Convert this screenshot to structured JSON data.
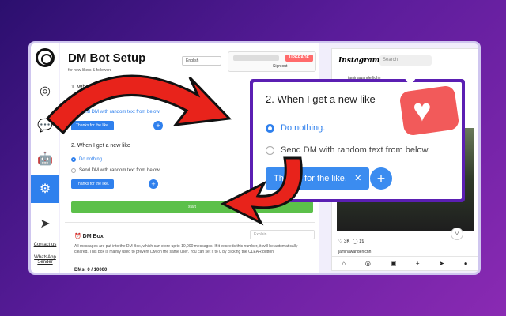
{
  "app": {
    "title": "DM Bot Setup",
    "subtitle": "for new likers & followers",
    "language": "English",
    "upgrade_label": "UPGRADE",
    "signout_label": "Sign out"
  },
  "sidebar": {
    "links": [
      "Contact us",
      "WhatsApp Sender"
    ],
    "icons": [
      "instagram-icon",
      "chat-icon",
      "bot-icon",
      "settings-icon",
      "send-icon"
    ]
  },
  "follower_section": {
    "title": "1. When I get a new follower",
    "option_nothing": "Do nothing.",
    "option_send": "Send DM with random text from below."
  },
  "like_section": {
    "title": "2. When I get a new like",
    "option_nothing": "Do nothing.",
    "option_send": "Send DM with random text from below.",
    "chip_text": "Thanks for the like.",
    "chip_short": "Thanks for the like."
  },
  "start_label": "start",
  "dm_box": {
    "title": "DM Box",
    "explain_placeholder": "Explain",
    "description": "All messages are put into the DM Box, which can store up to 10,000 messages. If it exceeds this number, it will be automatically cleared. This box is mainly used to prevent DM on the same user. You can set it to 0 by clicking the CLEAR button.",
    "count": "DMs: 0 / 10000"
  },
  "callout": {
    "title": "2. When I get a new like",
    "option_nothing": "Do nothing.",
    "option_send": "Send DM with random text from below.",
    "chip_text": "Thanks for the like.",
    "close": "✕",
    "plus": "+"
  },
  "instagram": {
    "logo": "Instagram",
    "search_placeholder": "Search",
    "username": "jaminawanderlichh",
    "likes": "3K",
    "comments": "19",
    "caption_user": "jaminawanderlichh"
  },
  "colors": {
    "accent": "#2f80ed",
    "start": "#5cc04a",
    "callout_border": "#5b1fb3",
    "upgrade": "#ff6b6b",
    "arrow": "#e8231b"
  }
}
